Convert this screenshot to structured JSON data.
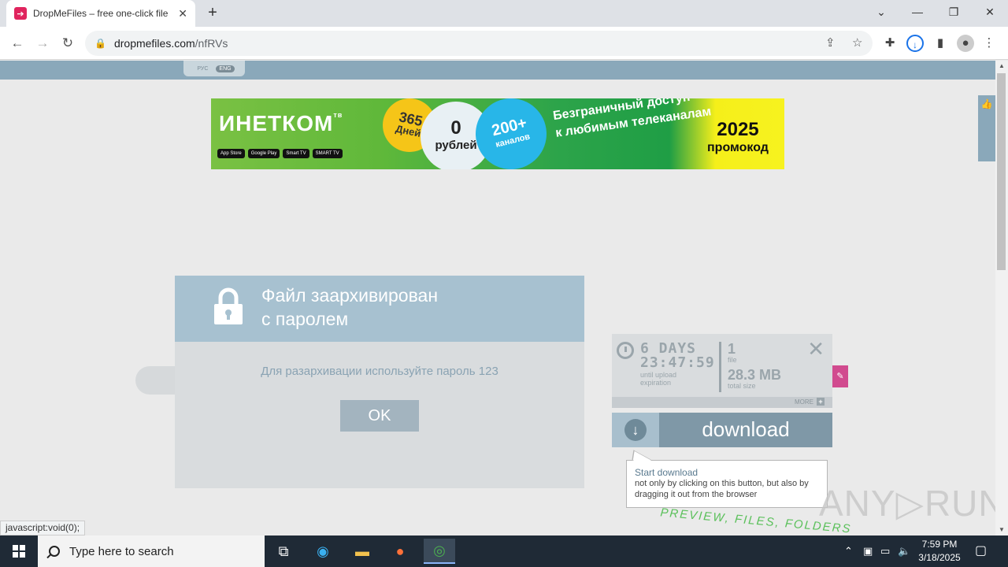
{
  "browser": {
    "tab_title": "DropMeFiles – free one-click file",
    "tab_close": "✕",
    "new_tab": "+",
    "url_host": "dropmefiles.com",
    "url_path": "/nfRVs",
    "window_controls": {
      "dropdown": "⌄",
      "minimize": "—",
      "restore": "❐",
      "close": "✕"
    }
  },
  "page": {
    "lang": {
      "ru": "РУС",
      "en": "ENG",
      "active": "ENG"
    },
    "banner": {
      "brand": "ИНЕТКОМ",
      "brand_sup": "тв",
      "stores": [
        "App Store",
        "Google Play",
        "Smart TV",
        "SMART TV"
      ],
      "days_num": "365",
      "days_word": "Дней",
      "price_num": "0",
      "price_word": "рублей",
      "channels_num": "200+",
      "channels_word": "каналов",
      "tagline_1": "Безграничный доступ",
      "tagline_2": "к любимым телеканалам",
      "promo_year": "2025",
      "promo_word": "промокод"
    },
    "modal": {
      "title_line1": "Файл заархивирован",
      "title_line2": "с паролем",
      "message": "Для разархивации используйте пароль 123",
      "ok_label": "OK"
    },
    "download": {
      "days": "6 DAYS",
      "time": "23:47:59",
      "until_1": "until upload",
      "until_2": "expiration",
      "file_count": "1",
      "file_label": "file",
      "total_size": "28.3 MB",
      "size_label": "total size",
      "close": "✕",
      "more": "MORE",
      "more_plus": "+",
      "button_label": "download",
      "tooltip_title": "Start download",
      "tooltip_body": "not only by clicking on this button, but also by dragging it out from the browser",
      "preview_text": "PREVIEW, FILES, FOLDERS"
    },
    "watermark": "ANY▷RUN",
    "status_text": "javascript:void(0);"
  },
  "taskbar": {
    "search_placeholder": "Type here to search",
    "time": "7:59 PM",
    "date": "3/18/2025"
  },
  "colors": {
    "header_band": "#8aa8ba",
    "modal_head": "#a7c1d0",
    "download_button": "#7f98a7",
    "banner_green": "#2da44a",
    "banner_yellow": "#f5ef1a"
  }
}
